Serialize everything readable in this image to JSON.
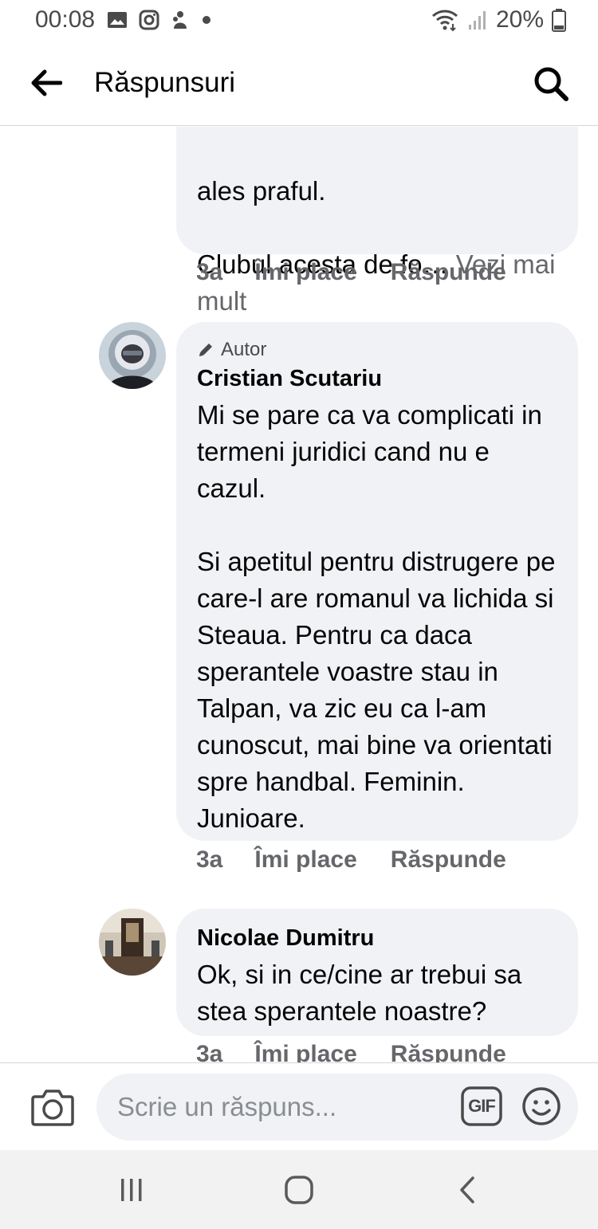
{
  "status_bar": {
    "time": "00:08",
    "battery": "20%",
    "left_icons": [
      "gallery-icon",
      "instagram-icon",
      "notification-icon",
      "dot-icon"
    ],
    "right_icons": [
      "wifi-icon",
      "signal-icon",
      "battery-icon"
    ]
  },
  "header": {
    "title": "Răspunsuri",
    "back_icon": "arrow-left-icon",
    "search_icon": "search-icon"
  },
  "comments": [
    {
      "partial": true,
      "text_lines": [
        "ales praful.",
        "Clubul acesta de fo… "
      ],
      "see_more": "Vezi mai mult",
      "time": "3a",
      "like_label": "Îmi place",
      "reply_label": "Răspunde"
    },
    {
      "author_badge": "Autor",
      "name": "Cristian Scutariu",
      "text": "Mi se pare ca va complicati in termeni juridici cand nu e cazul.\n\nSi apetitul pentru distrugere pe care-l are romanul va lichida si Steaua. Pentru ca daca sperantele voastre stau in Talpan, va zic eu ca l-am cunoscut, mai bine va orientati spre handbal. Feminin. Junioare.",
      "time": "3a",
      "like_label": "Îmi place",
      "reply_label": "Răspunde"
    },
    {
      "name": "Nicolae Dumitru",
      "text": "Ok, si in ce/cine ar trebui sa stea sperantele noastre?",
      "time": "3a",
      "like_label": "Îmi place",
      "reply_label": "Răspunde"
    }
  ],
  "composer": {
    "placeholder": "Scrie un răspuns...",
    "gif_label": "GIF",
    "camera_icon": "camera-icon",
    "emoji_icon": "emoji-icon"
  },
  "nav": {
    "icons": [
      "recent-apps-icon",
      "home-icon",
      "back-icon"
    ]
  },
  "colors": {
    "bubble": "#f0f2f5",
    "meta_text": "#65676b",
    "primary_text": "#050505"
  }
}
